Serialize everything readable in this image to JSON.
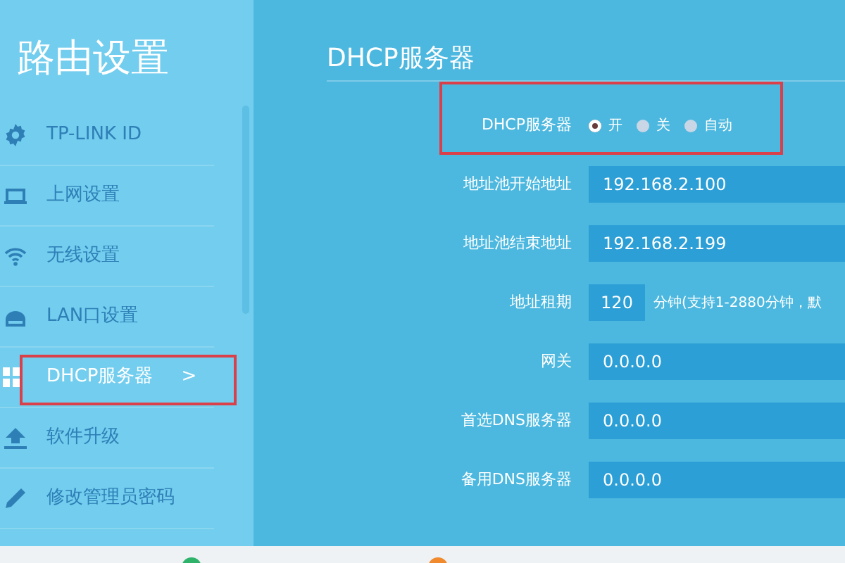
{
  "sidebar": {
    "title": "路由设置",
    "items": [
      {
        "label": "TP-LINK ID",
        "selected": false
      },
      {
        "label": "上网设置",
        "selected": false
      },
      {
        "label": "无线设置",
        "selected": false
      },
      {
        "label": "LAN口设置",
        "selected": false
      },
      {
        "label": "DHCP服务器",
        "selected": true,
        "arrow": ">",
        "highlighted": true
      },
      {
        "label": "软件升级",
        "selected": false
      },
      {
        "label": "修改管理员密码",
        "selected": false
      }
    ]
  },
  "page": {
    "title": "DHCP服务器",
    "server": {
      "label": "DHCP服务器",
      "highlighted": true,
      "options": [
        {
          "label": "开",
          "selected": true
        },
        {
          "label": "关",
          "selected": false
        },
        {
          "label": "自动",
          "selected": false
        }
      ]
    },
    "fields": [
      {
        "label": "地址池开始地址",
        "value": "192.168.2.100",
        "kind": "wide"
      },
      {
        "label": "地址池结束地址",
        "value": "192.168.2.199",
        "kind": "wide"
      },
      {
        "label": "地址租期",
        "value": "120",
        "kind": "short",
        "hint": "分钟(支持1-2880分钟，默"
      },
      {
        "label": "网关",
        "value": "0.0.0.0",
        "kind": "wide"
      },
      {
        "label": "首选DNS服务器",
        "value": "0.0.0.0",
        "kind": "wide"
      },
      {
        "label": "备用DNS服务器",
        "value": "0.0.0.0",
        "kind": "wide"
      }
    ]
  }
}
